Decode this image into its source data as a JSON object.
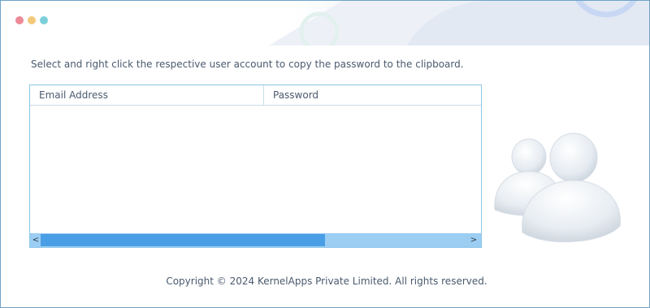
{
  "window": {
    "controls": [
      "close",
      "minimize",
      "maximize"
    ]
  },
  "instructions": "Select and right click the respective user account to copy the password to the clipboard.",
  "table": {
    "columns": [
      "Email Address",
      "Password"
    ],
    "rows": [],
    "scrollbar": {
      "left_arrow": "<",
      "right_arrow": ">"
    }
  },
  "footer": {
    "copyright": "Copyright © 2024 KernelApps Private Limited. All rights reserved."
  },
  "colors": {
    "border": "#6fa3c9",
    "text": "#4a5a6e",
    "scroll_track": "#9ccdf3",
    "scroll_thumb": "#4a9ee6",
    "dot_close": "#ec8a96",
    "dot_minimize": "#f2c97a",
    "dot_maximize": "#7ccfd8"
  },
  "icons": {
    "illustration": "users-icon"
  }
}
